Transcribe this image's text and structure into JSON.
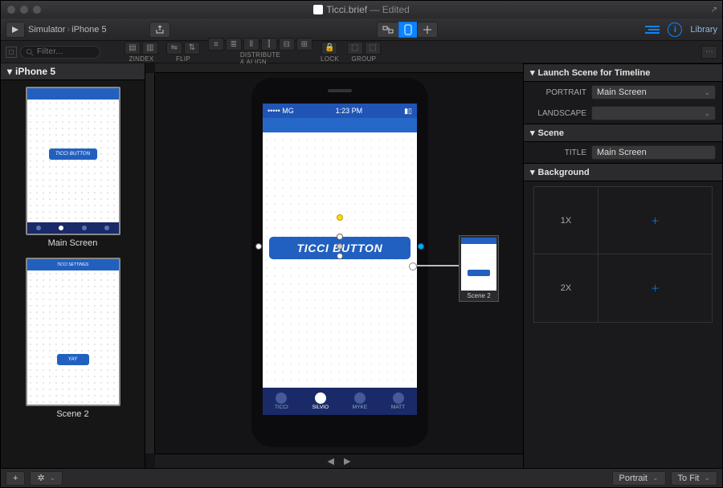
{
  "title": {
    "filename": "Ticci.brief",
    "suffix": "— Edited"
  },
  "toolbar": {
    "simulator": "Simulator",
    "device": "iPhone 5",
    "library": "Library"
  },
  "toolbar2": {
    "filter_placeholder": "Filter...",
    "groups": {
      "zindex": "ZINDEX",
      "flip": "FLIP",
      "distribute": "DISTRIBUTE\n& ALIGN",
      "lock": "LOCK",
      "group": "GROUP"
    }
  },
  "sidebar": {
    "header": "iPhone 5",
    "scenes": [
      {
        "label": "Main Screen",
        "button_text": "TICCI BUTTON",
        "selected": false
      },
      {
        "label": "Scene 2",
        "button_text": "YAY",
        "selected": false,
        "header_text": "TICCI SETTINGS"
      }
    ]
  },
  "canvas": {
    "status_time": "1:23 PM",
    "status_left": "••••• MG",
    "button_text": "TICCI BUTTON",
    "tabs": [
      "TICCI",
      "SILVIO",
      "MYKE",
      "MATT"
    ],
    "active_tab_index": 1,
    "mini_scene_label": "Scene 2"
  },
  "inspector": {
    "sections": {
      "launch": "Launch Scene for Timeline",
      "scene": "Scene",
      "background": "Background"
    },
    "portrait_label": "PORTRAIT",
    "portrait_value": "Main Screen",
    "landscape_label": "LANDSCAPE",
    "landscape_value": "",
    "title_label": "TITLE",
    "title_value": "Main Screen",
    "bg_rows": [
      "1X",
      "2X"
    ]
  },
  "footer": {
    "orientation": "Portrait",
    "zoom": "To Fit"
  }
}
